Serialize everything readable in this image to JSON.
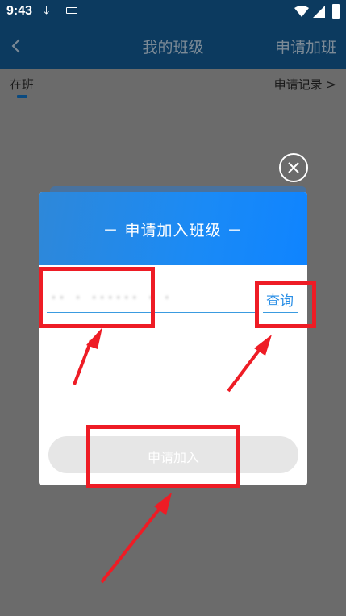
{
  "status_bar": {
    "time": "9:43",
    "icons": [
      "download-icon",
      "keyboard-icon",
      "wifi-icon",
      "signal-icon",
      "battery-icon"
    ]
  },
  "title_bar": {
    "title": "我的班级",
    "action_label": "申请加班"
  },
  "tabs": {
    "active": "在班",
    "records_label": "申请记录 >"
  },
  "dialog": {
    "title": "－ 申请加入班级 －",
    "class_code_value": "·· · ······ · ·",
    "query_label": "查询",
    "submit_label": "申请加入"
  },
  "colors": {
    "app_bar": "#0c3a5f",
    "overlay": "#6b6b6b",
    "dialog_header": "#1a8af6",
    "accent": "#2b8fe6",
    "annotation": "#ee1c25"
  }
}
